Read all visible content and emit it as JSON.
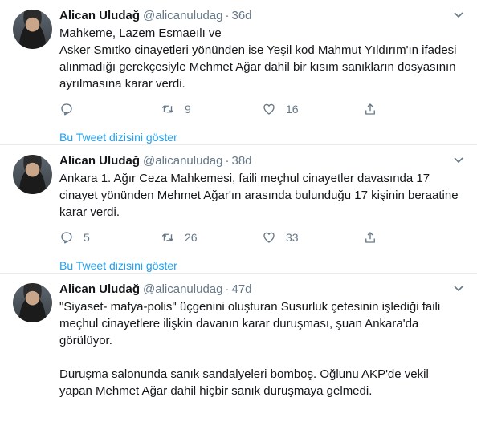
{
  "tweets": [
    {
      "name": "Alican Uludağ",
      "handle": "@alicanuludag",
      "dot": "·",
      "time": "36d",
      "text": "Mahkeme, Lazem Esmaeılı ve\nAsker Smıtko cinayetleri yönünden ise Yeşil kod Mahmut Yıldırım'ın ifadesi alınmadığı gerekçesiyle Mehmet Ağar dahil bir kısım sanıkların dosyasının ayrılmasına karar verdi.",
      "replies": "",
      "retweets": "9",
      "likes": "16",
      "thread_link": "Bu Tweet dizisini göster"
    },
    {
      "name": "Alican Uludağ",
      "handle": "@alicanuludag",
      "dot": "·",
      "time": "38d",
      "text": "Ankara 1. Ağır Ceza Mahkemesi, faili meçhul cinayetler davasında 17 cinayet yönünden Mehmet Ağar'ın arasında bulunduğu 17 kişinin beraatine karar verdi.",
      "replies": "5",
      "retweets": "26",
      "likes": "33",
      "thread_link": "Bu Tweet dizisini göster"
    },
    {
      "name": "Alican Uludağ",
      "handle": "@alicanuludag",
      "dot": "·",
      "time": "47d",
      "text": "\"Siyaset- mafya-polis\" üçgenini oluşturan Susurluk çetesinin işlediği faili meçhul cinayetlere ilişkin davanın karar duruşması, şuan Ankara'da görülüyor.\n\nDuruşma salonunda sanık sandalyeleri bomboş. Oğlunu AKP'de vekil yapan Mehmet Ağar dahil hiçbir sanık duruşmaya gelmedi.",
      "replies": "",
      "retweets": "",
      "likes": "",
      "thread_link": ""
    }
  ]
}
